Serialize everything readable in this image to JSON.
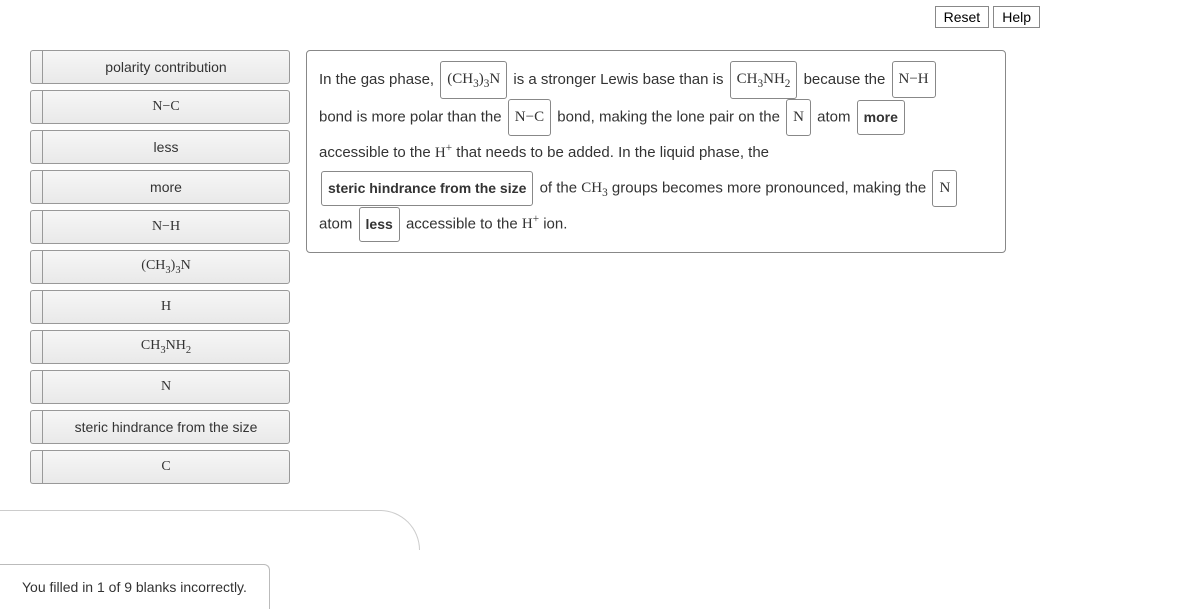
{
  "buttons": {
    "reset": "Reset",
    "help": "Help"
  },
  "tiles": [
    {
      "html": "polarity contribution"
    },
    {
      "html": "<span class='chem'>N−C</span>"
    },
    {
      "html": "less"
    },
    {
      "html": "more"
    },
    {
      "html": "<span class='chem'>N−H</span>"
    },
    {
      "html": "<span class='chem'>(CH<sub>3</sub>)<sub>3</sub>N</span>"
    },
    {
      "html": "<span class='chem'>H</span>"
    },
    {
      "html": "<span class='chem'>CH<sub>3</sub>NH<sub>2</sub></span>"
    },
    {
      "html": "<span class='chem'>N</span>"
    },
    {
      "html": "steric hindrance from the size"
    },
    {
      "html": "<span class='chem'>C</span>"
    }
  ],
  "sentence": {
    "t1": "In the gas phase, ",
    "s1": "(CH<sub>3</sub>)<sub>3</sub>N",
    "t2": " is a stronger Lewis base than is ",
    "s2": "CH<sub>3</sub>NH<sub>2</sub>",
    "t3": " because the ",
    "s3": "N−H",
    "t4": "bond is more polar than the ",
    "s4": "N−C",
    "t5": " bond, making the lone pair on the ",
    "s5": "N",
    "t6": " atom ",
    "s6": "more",
    "t7": "accessible to the ",
    "hplus1": "H<sup>+</sup>",
    "t8": " that needs to be added. In the liquid phase, the",
    "s7": "steric hindrance from the size",
    "t9": " of the ",
    "ch3": "CH<sub>3</sub>",
    "t10": " groups becomes more pronounced, making the ",
    "s8": "N",
    "t11": "atom ",
    "s9": "less",
    "t12": " accessible to the ",
    "hplus2": "H<sup>+</sup>",
    "t13": " ion."
  },
  "feedback": "You filled in 1 of 9 blanks incorrectly."
}
